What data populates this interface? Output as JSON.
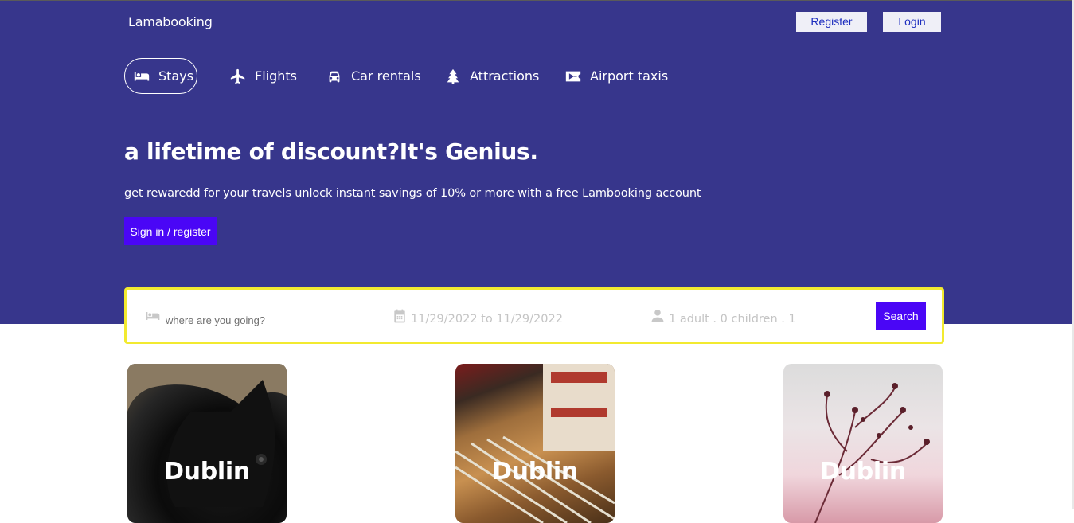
{
  "header": {
    "brand": "Lamabooking",
    "register_label": "Register",
    "login_label": "Login"
  },
  "nav": {
    "items": [
      {
        "label": "Stays",
        "icon": "bed-icon",
        "active": true
      },
      {
        "label": "Flights",
        "icon": "plane-icon",
        "active": false
      },
      {
        "label": "Car rentals",
        "icon": "car-icon",
        "active": false
      },
      {
        "label": "Attractions",
        "icon": "tree-icon",
        "active": false
      },
      {
        "label": "Airport taxis",
        "icon": "taxi-ticket-icon",
        "active": false
      }
    ]
  },
  "hero": {
    "title": "a lifetime of discount?It's Genius.",
    "description": "get rewaredd for your travels unlock instant savings of 10% or more with a free Lambooking account",
    "signin_label": "Sign in / register"
  },
  "search": {
    "destination_placeholder": "where are you going?",
    "date_range": "11/29/2022 to 11/29/2022",
    "options": "1 adult . 0 children . 1",
    "search_label": "Search"
  },
  "featured": [
    {
      "city": "Dublin"
    },
    {
      "city": "Dublin"
    },
    {
      "city": "Dublin"
    }
  ],
  "colors": {
    "hero_bg": "#37368c",
    "accent_button": "#4a06f6",
    "search_border": "#f2ea30"
  }
}
